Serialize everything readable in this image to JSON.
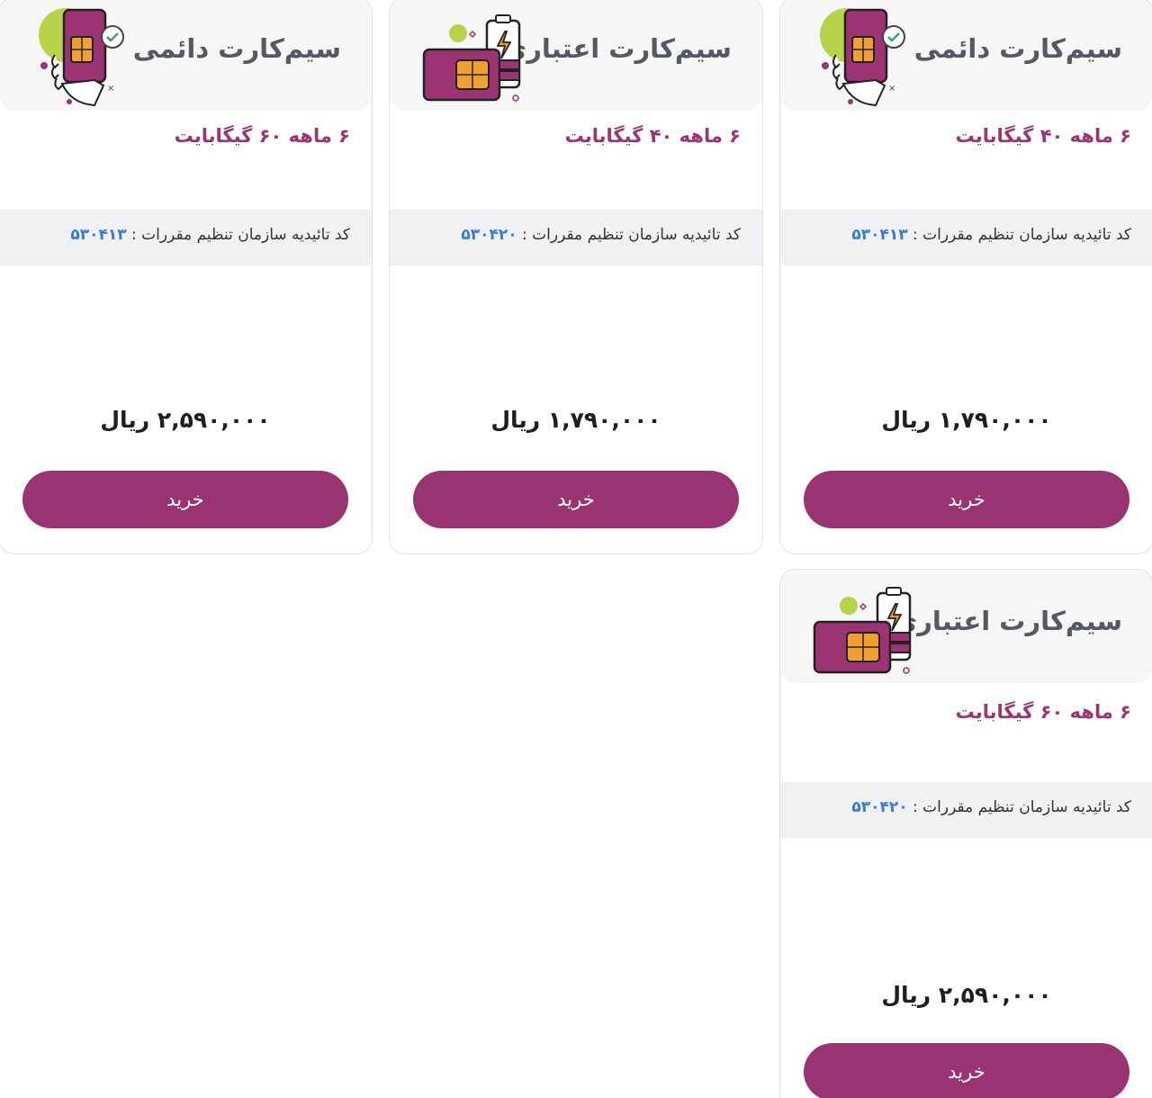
{
  "colors": {
    "accent": "#993371",
    "plan_text": "#9c3373",
    "code_text": "#3a7bd5",
    "header_bg": "#f6f6f7",
    "reg_bg": "#f0f1f3"
  },
  "cards": [
    {
      "title": "سیم‌کارت دائمی",
      "icon": "permanent-sim-hand-icon",
      "plan": "۶ ماهه ۴۰ گیگابایت",
      "reg_label": "کد تائیدیه سازمان تنظیم مقررات : ",
      "reg_code": "۵۳۰۴۱۳",
      "price": "۱,۷۹۰,۰۰۰ ریال",
      "buy_label": "خرید"
    },
    {
      "title": "سیم‌کارت اعتباری",
      "icon": "prepaid-sim-battery-icon",
      "plan": "۶ ماهه ۴۰ گیگابایت",
      "reg_label": "کد تائیدیه سازمان تنظیم مقررات : ",
      "reg_code": "۵۳۰۴۲۰",
      "price": "۱,۷۹۰,۰۰۰ ریال",
      "buy_label": "خرید"
    },
    {
      "title": "سیم‌کارت دائمی",
      "icon": "permanent-sim-hand-icon",
      "plan": "۶ ماهه ۶۰ گیگابایت",
      "reg_label": "کد تائیدیه سازمان تنظیم مقررات : ",
      "reg_code": "۵۳۰۴۱۳",
      "price": "۲,۵۹۰,۰۰۰ ریال",
      "buy_label": "خرید"
    },
    {
      "title": "سیم‌کارت اعتباری",
      "icon": "prepaid-sim-battery-icon",
      "plan": "۶ ماهه ۶۰ گیگابایت",
      "reg_label": "کد تائیدیه سازمان تنظیم مقررات : ",
      "reg_code": "۵۳۰۴۲۰",
      "price": "۲,۵۹۰,۰۰۰ ریال",
      "buy_label": "خرید"
    }
  ]
}
